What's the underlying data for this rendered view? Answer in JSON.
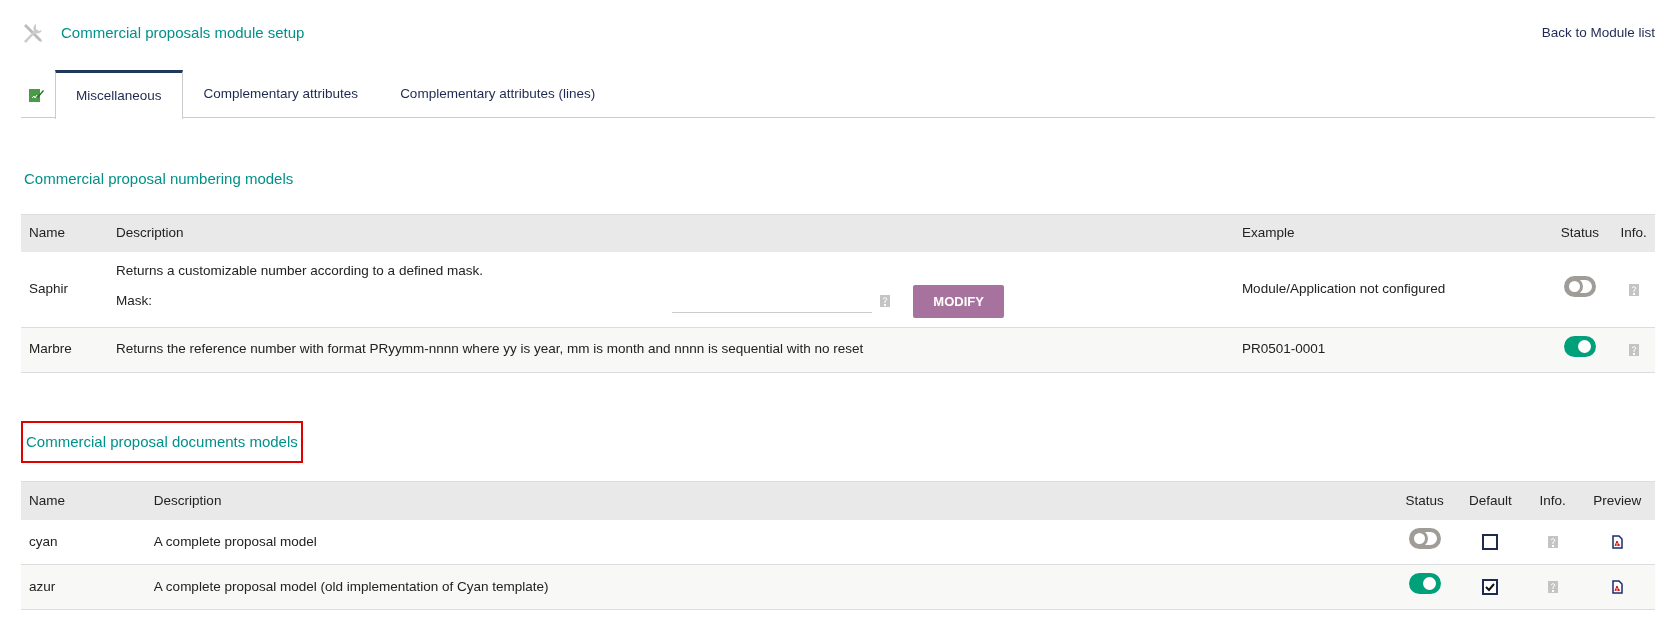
{
  "page_title": "Commercial proposals module setup",
  "back_link": "Back to Module list",
  "tabs": [
    {
      "kind": "icon",
      "selected": false
    },
    {
      "kind": "text",
      "label": "Miscellaneous",
      "selected": true
    },
    {
      "kind": "text",
      "label": "Complementary attributes",
      "selected": false
    },
    {
      "kind": "text",
      "label": "Complementary attributes (lines)",
      "selected": false
    }
  ],
  "numbering": {
    "title": "Commercial proposal numbering models",
    "highlighted": false,
    "columns": [
      "Name",
      "Description",
      "Example",
      "Status",
      "Info."
    ],
    "rows": [
      {
        "name": "Saphir",
        "description": "Returns a customizable number according to a defined mask.",
        "mask_label": "Mask:",
        "mask_value": "",
        "button": "MODIFY",
        "example": "Module/Application not configured",
        "on": false
      },
      {
        "name": "Marbre",
        "description": "Returns the reference number with format PRyymm-nnnn where yy is year, mm is month and nnnn is sequential with no reset",
        "example": "PR0501-0001",
        "on": true
      }
    ]
  },
  "documents": {
    "title": "Commercial proposal documents models",
    "highlighted": true,
    "columns": [
      "Name",
      "Description",
      "Status",
      "Default",
      "Info.",
      "Preview"
    ],
    "rows": [
      {
        "name": "cyan",
        "description": "A complete proposal model",
        "on": false,
        "checked": false
      },
      {
        "name": "azur",
        "description": "A complete proposal model (old implementation of Cyan template)",
        "on": true,
        "checked": true
      }
    ]
  }
}
